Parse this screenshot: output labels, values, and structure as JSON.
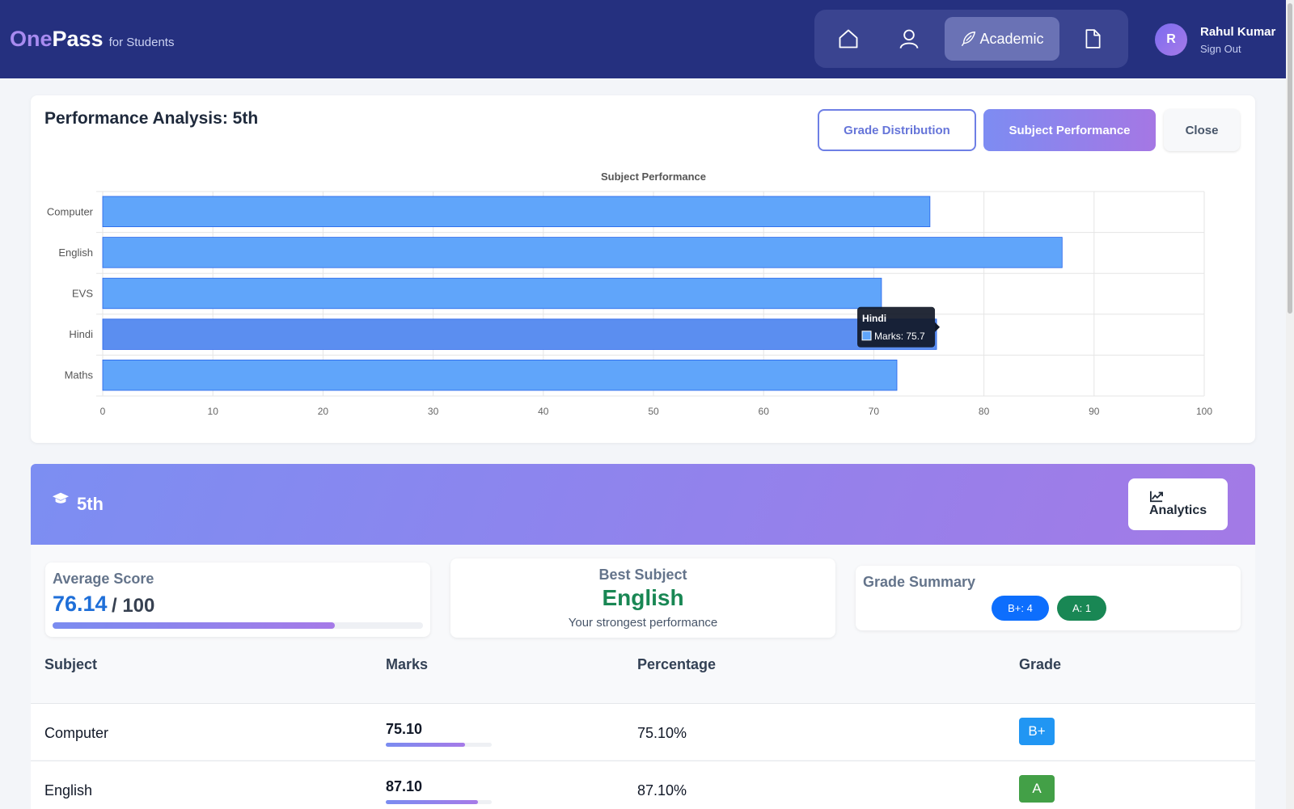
{
  "header": {
    "brand_one": "One",
    "brand_pass": "Pass",
    "brand_for": "for Students",
    "nav": {
      "home_icon": "home-icon",
      "profile_icon": "user-icon",
      "academic_label": "Academic",
      "academic_icon": "feather-icon",
      "documents_icon": "document-icon"
    },
    "user": {
      "initial": "R",
      "name": "Rahul Kumar",
      "signout": "Sign Out"
    }
  },
  "analysis": {
    "title": "Performance Analysis: 5th",
    "buttons": {
      "grade_distribution": "Grade Distribution",
      "subject_performance": "Subject Performance",
      "close": "Close"
    }
  },
  "chart_data": {
    "type": "bar",
    "orientation": "horizontal",
    "title": "Subject Performance",
    "categories": [
      "Computer",
      "English",
      "EVS",
      "Hindi",
      "Maths"
    ],
    "series": [
      {
        "name": "Marks",
        "values": [
          75.1,
          87.1,
          70.7,
          75.7,
          72.1
        ]
      }
    ],
    "xlim": [
      0,
      100
    ],
    "xticks": [
      0,
      10,
      20,
      30,
      40,
      50,
      60,
      70,
      80,
      90,
      100
    ],
    "grid": true,
    "bar_color": "#60a5fa",
    "tooltip": {
      "category": "Hindi",
      "label": "Marks: 75.7"
    }
  },
  "grade": {
    "title": "5th",
    "analytics_label": "Analytics",
    "average": {
      "label": "Average Score",
      "value": "76.14",
      "out_of": "/ 100",
      "fraction": 0.7614
    },
    "best": {
      "label": "Best Subject",
      "value": "English",
      "sub": "Your strongest performance"
    },
    "summary": {
      "label": "Grade Summary",
      "badges": [
        "B+: 4",
        "A: 1"
      ]
    },
    "table": {
      "headers": [
        "Subject",
        "Marks",
        "Percentage",
        "Grade"
      ],
      "rows": [
        {
          "subject": "Computer",
          "marks": "75.10",
          "percentage": "75.10%",
          "grade": "B+",
          "fraction": 0.751,
          "color": "#2196f3"
        },
        {
          "subject": "English",
          "marks": "87.10",
          "percentage": "87.10%",
          "grade": "A",
          "fraction": 0.871,
          "color": "#43a047"
        }
      ]
    }
  }
}
